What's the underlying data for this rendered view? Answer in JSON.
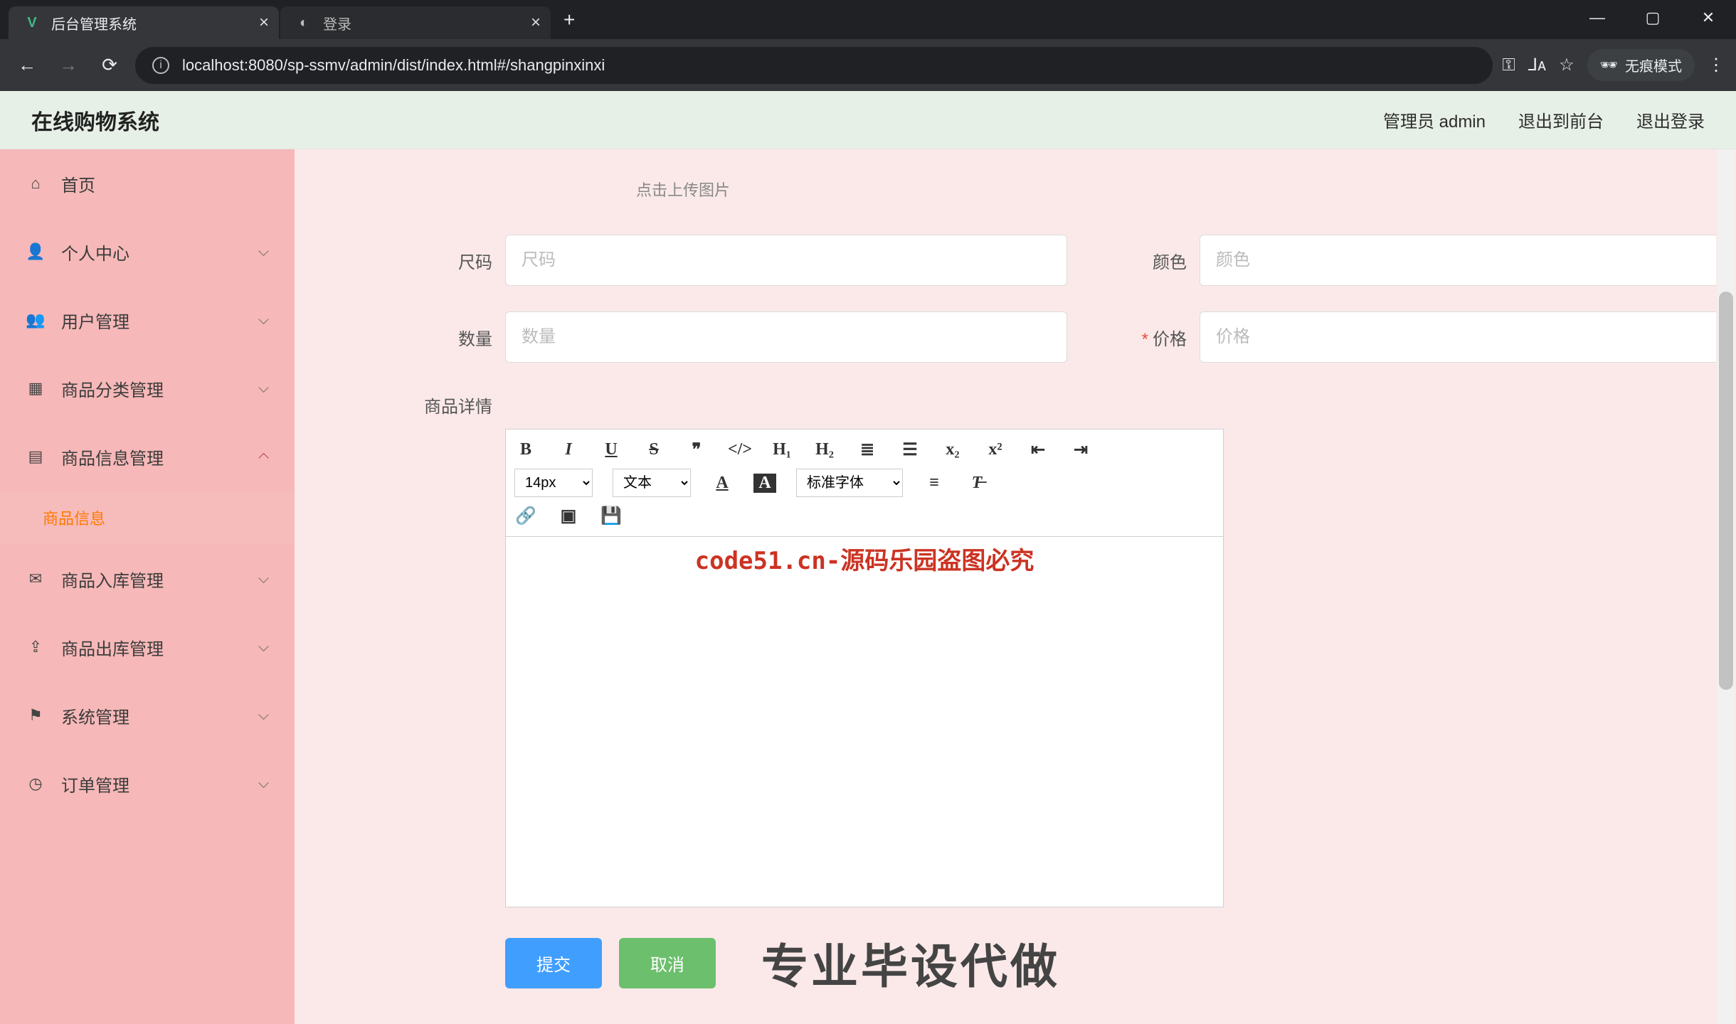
{
  "browser": {
    "tabs": [
      {
        "title": "后台管理系统",
        "favicon": "V"
      },
      {
        "title": "登录",
        "favicon": "◐"
      }
    ],
    "url": "localhost:8080/sp-ssmv/admin/dist/index.html#/shangpinxinxi",
    "incognito_label": "无痕模式"
  },
  "header": {
    "app_title": "在线购物系统",
    "user_role": "管理员 admin",
    "to_front": "退出到前台",
    "logout": "退出登录"
  },
  "sidebar": {
    "items": [
      {
        "label": "首页",
        "icon": "⌂",
        "expandable": false
      },
      {
        "label": "个人中心",
        "icon": "👤",
        "expandable": true
      },
      {
        "label": "用户管理",
        "icon": "👥",
        "expandable": true
      },
      {
        "label": "商品分类管理",
        "icon": "▦",
        "expandable": true
      },
      {
        "label": "商品信息管理",
        "icon": "▤",
        "expandable": true,
        "expanded": true,
        "children": [
          {
            "label": "商品信息"
          }
        ]
      },
      {
        "label": "商品入库管理",
        "icon": "✉",
        "expandable": true
      },
      {
        "label": "商品出库管理",
        "icon": "⇪",
        "expandable": true
      },
      {
        "label": "系统管理",
        "icon": "⚑",
        "expandable": true
      },
      {
        "label": "订单管理",
        "icon": "◷",
        "expandable": true
      }
    ]
  },
  "form": {
    "upload_hint": "点击上传图片",
    "fields": {
      "size_label": "尺码",
      "size_placeholder": "尺码",
      "color_label": "颜色",
      "color_placeholder": "颜色",
      "qty_label": "数量",
      "qty_placeholder": "数量",
      "price_label": "价格",
      "price_placeholder": "价格",
      "detail_label": "商品详情"
    },
    "editor_toolbar": {
      "font_size": "14px",
      "text_style": "文本",
      "font_family": "标准字体"
    },
    "buttons": {
      "submit": "提交",
      "cancel": "取消"
    }
  },
  "watermark_text": "code51.cn",
  "watermark_center": "code51.cn-源码乐园盗图必究",
  "footer_big": "专业毕设代做"
}
